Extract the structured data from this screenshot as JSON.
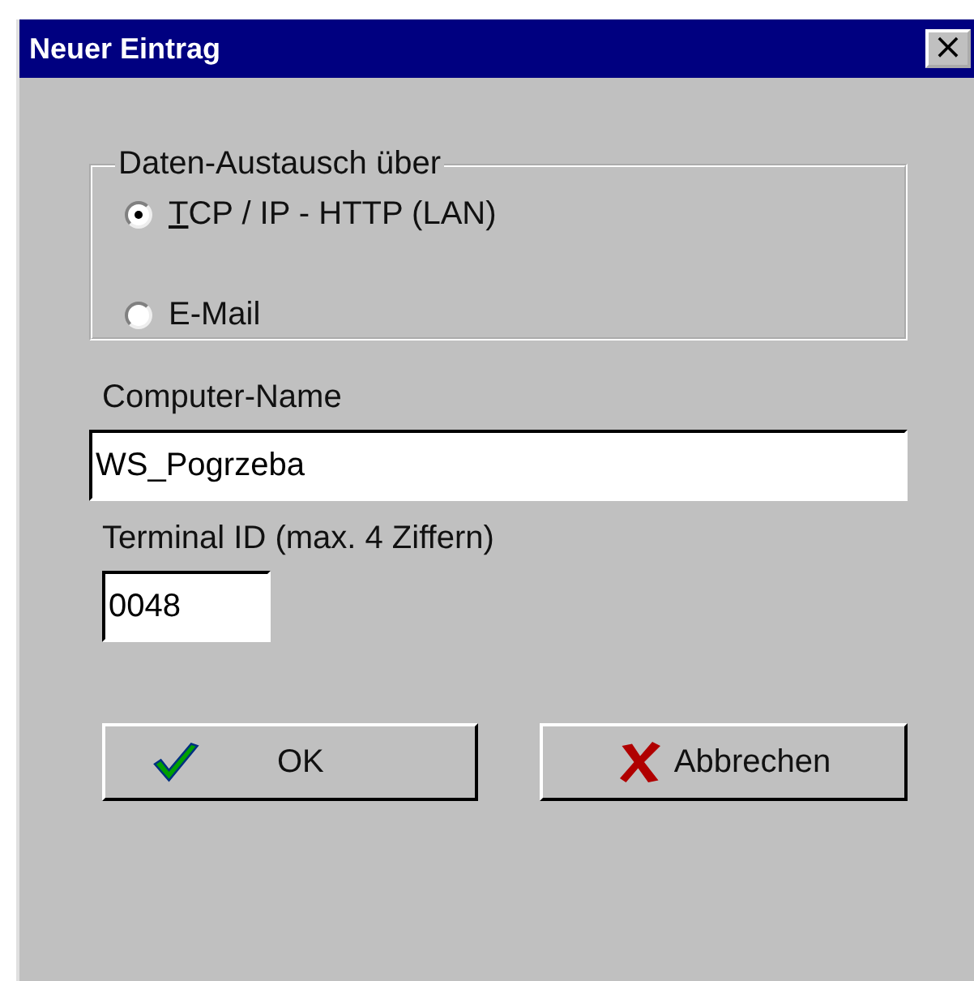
{
  "window": {
    "title": "Neuer Eintrag",
    "close": "×"
  },
  "group": {
    "legend": "Daten-Austausch über",
    "options": [
      {
        "label": "TCP / IP - HTTP (LAN)",
        "selected": true,
        "mnemonic_first": true
      },
      {
        "label": "E-Mail",
        "selected": false,
        "mnemonic_first": false
      }
    ]
  },
  "fields": [
    {
      "label": "Computer-Name",
      "value": "WS_Pogrzeba",
      "kind": "wide"
    },
    {
      "label": "Terminal ID (max. 4 Ziffern)",
      "value": "0048",
      "kind": "short"
    }
  ],
  "buttons": [
    {
      "label": "OK",
      "kind": "ok"
    },
    {
      "label": "Abbrechen",
      "kind": "cancel"
    }
  ]
}
